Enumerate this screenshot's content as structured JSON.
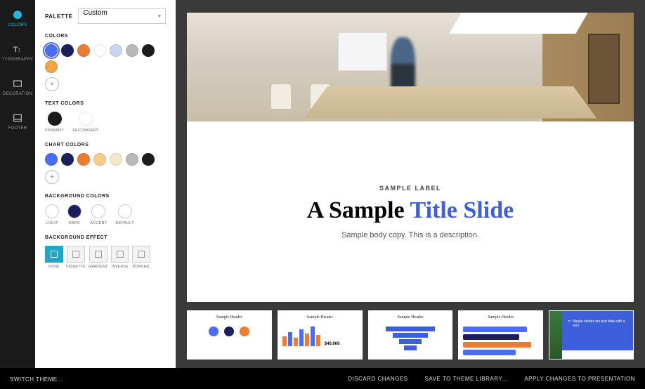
{
  "nav": [
    {
      "key": "colors",
      "label": "COLORS",
      "active": true
    },
    {
      "key": "typography",
      "label": "TYPOGRAPHY",
      "active": false
    },
    {
      "key": "decoration",
      "label": "DECORATION",
      "active": false
    },
    {
      "key": "footer",
      "label": "FOOTER",
      "active": false
    }
  ],
  "palette": {
    "label": "PALETTE",
    "value": "Custom"
  },
  "sections": {
    "colors": {
      "title": "COLORS",
      "swatches": [
        "#4a6cf7",
        "#1a1f5c",
        "#ee7b2f",
        "#ffffff",
        "#c9d4f5",
        "#b9b9b9",
        "#1b1b1b",
        "#f0a44a"
      ]
    },
    "text_colors": {
      "title": "TEXT COLORS",
      "items": [
        {
          "color": "#1b1b1b",
          "label": "PRIMARY"
        },
        {
          "color": "#ffffff",
          "label": "SECONDARY"
        }
      ]
    },
    "chart_colors": {
      "title": "CHART COLORS",
      "swatches": [
        "#4a6cf7",
        "#1a1f5c",
        "#ee7b2f",
        "#f6cc8d",
        "#f3e7ce",
        "#b9b9b9",
        "#1b1b1b"
      ]
    },
    "background_colors": {
      "title": "BACKGROUND COLORS",
      "items": [
        {
          "color": "#ffffff",
          "label": "LIGHT"
        },
        {
          "color": "#1a1f5c",
          "label": "DARK"
        },
        {
          "color": "#ffffff",
          "label": "ACCENT"
        },
        {
          "color": "#ffffff",
          "label": "DEFAULT"
        }
      ]
    },
    "background_effect": {
      "title": "BACKGROUND EFFECT",
      "items": [
        {
          "label": "NONE",
          "active": true
        },
        {
          "label": "VIGNETTE",
          "active": false
        },
        {
          "label": "GRADIENT",
          "active": false
        },
        {
          "label": "INVERSE",
          "active": false
        },
        {
          "label": "BORDER",
          "active": false
        }
      ]
    }
  },
  "slide": {
    "label": "SAMPLE LABEL",
    "title_plain": "A Sample",
    "title_accent": "Title Slide",
    "body": "Sample body copy. This is a description."
  },
  "thumbnails": [
    {
      "name": "Sample Header",
      "type": "icons"
    },
    {
      "name": "Sample Header",
      "type": "bars",
      "value": "$40,000"
    },
    {
      "name": "Sample Header",
      "type": "funnel"
    },
    {
      "name": "Sample Header",
      "type": "rows"
    },
    {
      "name": "",
      "type": "quote",
      "quote": "Maybe stories are just data with a soul"
    }
  ],
  "footer": {
    "switch_theme": "SWITCH THEME...",
    "discard": "DISCARD CHANGES",
    "save": "SAVE TO THEME LIBRARY...",
    "apply": "APPLY CHANGES TO PRESENTATION"
  },
  "icons": {
    "add": "+"
  }
}
